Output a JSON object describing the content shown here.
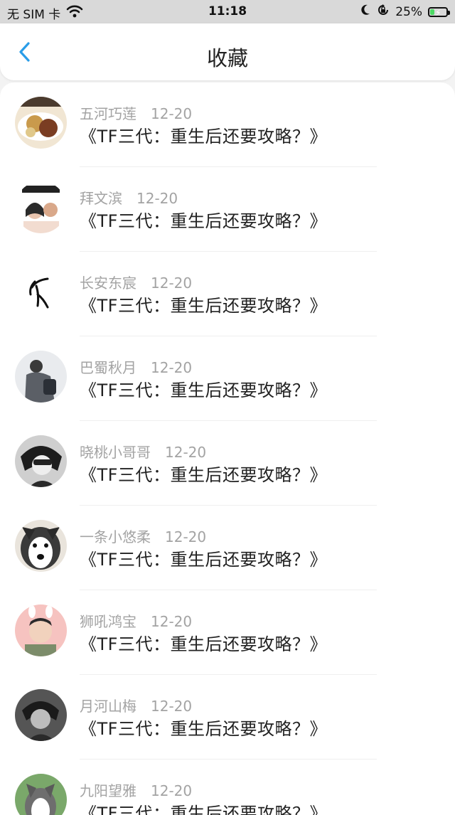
{
  "status_bar": {
    "carrier": "无 SIM 卡",
    "time": "11:18",
    "battery": "25%",
    "battery_level": 0.25,
    "icons": [
      "wifi-icon",
      "moon-icon",
      "orientation-lock-icon",
      "battery-icon"
    ]
  },
  "nav": {
    "title": "收藏",
    "back_icon": "chevron-left-icon",
    "accent": "#2a9de8"
  },
  "items": [
    {
      "name": "五河巧莲",
      "date": "12-20",
      "title": "《TF三代：重生后还要攻略？》"
    },
    {
      "name": "拜文滨",
      "date": "12-20",
      "title": "《TF三代：重生后还要攻略？》"
    },
    {
      "name": "长安东宸",
      "date": "12-20",
      "title": "《TF三代：重生后还要攻略？》"
    },
    {
      "name": "巴蜀秋月",
      "date": "12-20",
      "title": "《TF三代：重生后还要攻略？》"
    },
    {
      "name": "晓桃小哥哥",
      "date": "12-20",
      "title": "《TF三代：重生后还要攻略？》"
    },
    {
      "name": "一条小悠柔",
      "date": "12-20",
      "title": "《TF三代：重生后还要攻略？》"
    },
    {
      "name": "狮吼鸿宝",
      "date": "12-20",
      "title": "《TF三代：重生后还要攻略？》"
    },
    {
      "name": "月河山梅",
      "date": "12-20",
      "title": "《TF三代：重生后还要攻略？》"
    },
    {
      "name": "九阳望雅",
      "date": "12-20",
      "title": "《TF三代：重生后还要攻略？》"
    }
  ]
}
